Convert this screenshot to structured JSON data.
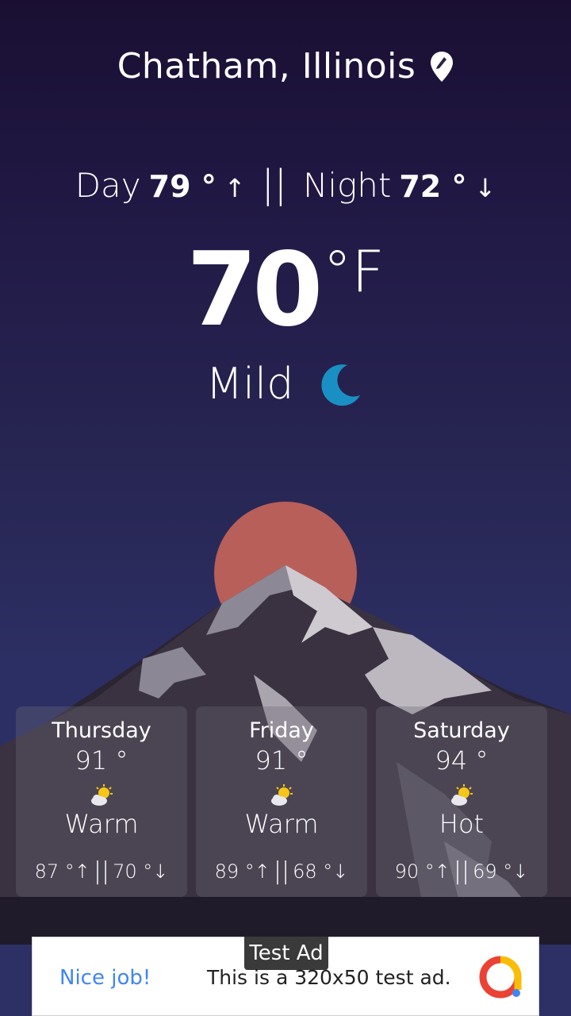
{
  "header": {
    "location": "Chatham, Illinois",
    "location_icon": "map-pin-icon"
  },
  "today": {
    "day_label": "Day",
    "day_temp": "79 °",
    "day_arrow": "↑",
    "separator": "||",
    "night_label": "Night",
    "night_temp": "72 °",
    "night_arrow": "↓",
    "current_temp": "70",
    "unit": "°F",
    "condition": "Mild",
    "condition_icon": "moon-icon"
  },
  "forecast": [
    {
      "day": "Thursday",
      "temp": "91 °",
      "icon": "partly-cloudy-icon",
      "condition": "Warm",
      "high": "87 °↑",
      "low": "70 °↓"
    },
    {
      "day": "Friday",
      "temp": "91 °",
      "icon": "partly-cloudy-icon",
      "condition": "Warm",
      "high": "89 °↑",
      "low": "68 °↓"
    },
    {
      "day": "Saturday",
      "temp": "94 °",
      "icon": "partly-cloudy-icon",
      "condition": "Hot",
      "high": "90 °↑",
      "low": "69 °↓"
    }
  ],
  "range_separator": "||",
  "ad": {
    "badge": "Test Ad",
    "cta": "Nice job!",
    "text": "This is a 320x50 test ad."
  },
  "colors": {
    "sun": "#b85f5a",
    "moon": "#1a8fc4",
    "ad_link": "#4285f4"
  }
}
